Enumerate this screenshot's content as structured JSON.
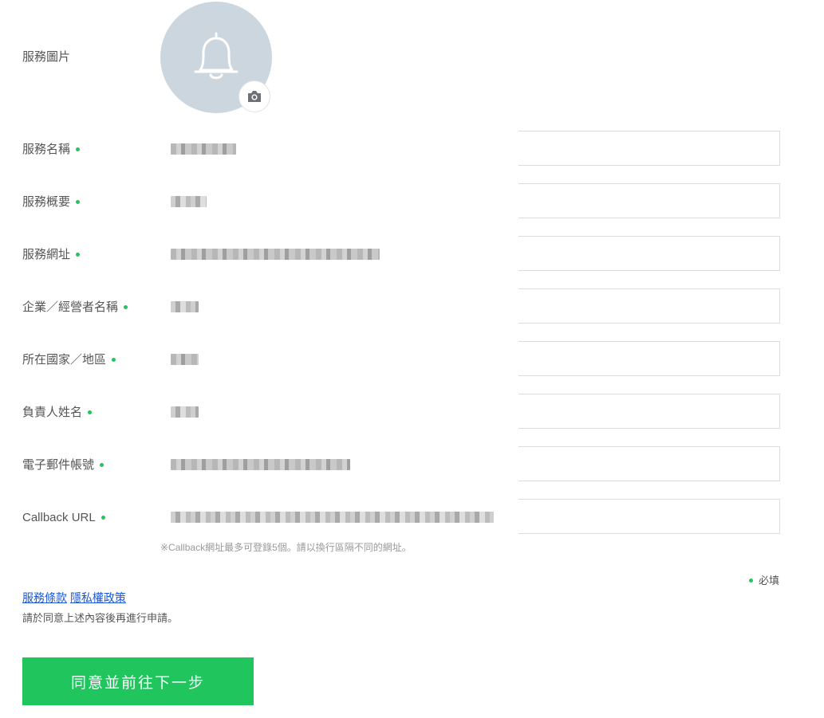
{
  "labels": {
    "service_image": "服務圖片",
    "service_name": "服務名稱",
    "service_summary": "服務概要",
    "service_url": "服務網址",
    "company_name": "企業／經營者名稱",
    "country": "所在國家／地區",
    "owner_name": "負責人姓名",
    "email": "電子郵件帳號",
    "callback_url": "Callback URL"
  },
  "hints": {
    "callback": "※Callback網址最多可登錄5個。請以換行區隔不同的網址。"
  },
  "required_note": "必填",
  "terms": {
    "service_terms": "服務條款",
    "privacy_policy": "隱私權政策",
    "agree_text": "請於同意上述內容後再進行申請。"
  },
  "buttons": {
    "next": "同意並前往下一步"
  },
  "icons": {
    "avatar": "bell-icon",
    "upload": "camera-icon"
  },
  "colors": {
    "accent": "#22c45e",
    "avatar_bg": "#cbd6df",
    "link": "#1a56d6"
  }
}
